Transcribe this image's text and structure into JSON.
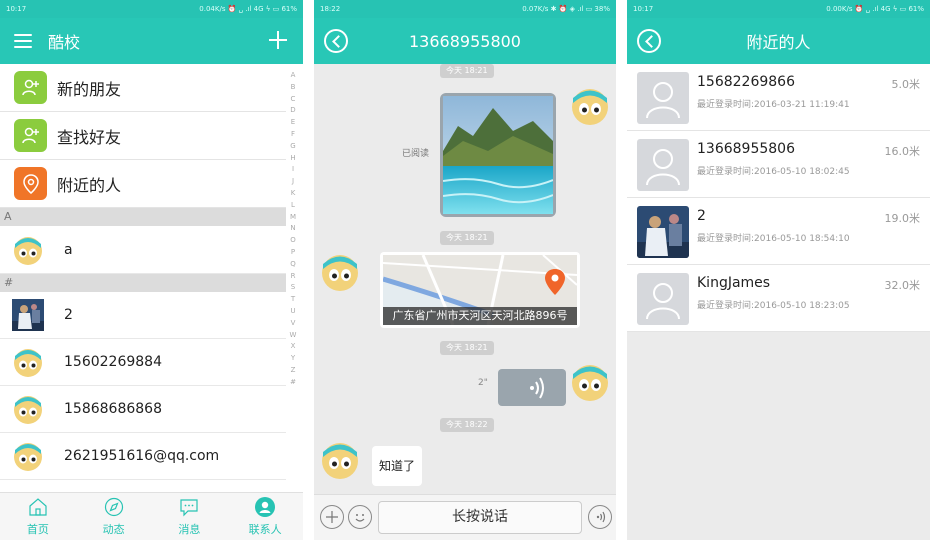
{
  "screen1": {
    "status_time": "10:17",
    "status_right": "0.04K/s ⏰ ␣ .ıl 4G ϟ ▭ 61%",
    "title": "酷校",
    "features": [
      {
        "label": "新的朋友",
        "icon": "person-add-icon",
        "color": "#8bcc3e"
      },
      {
        "label": "查找好友",
        "icon": "person-add-icon",
        "color": "#8bcc3e"
      },
      {
        "label": "附近的人",
        "icon": "location-pin-icon",
        "color": "#f07528"
      }
    ],
    "section_a": "A",
    "section_hash": "#",
    "contacts_a": [
      {
        "name": "a",
        "avatar": "cartoon"
      }
    ],
    "contacts_hash": [
      {
        "name": "2",
        "avatar": "photo"
      },
      {
        "name": "15602269884",
        "avatar": "cartoon"
      },
      {
        "name": "15868686868",
        "avatar": "cartoon"
      },
      {
        "name": "2621951616@qq.com",
        "avatar": "cartoon"
      }
    ],
    "index_letters": [
      "A",
      "B",
      "C",
      "D",
      "E",
      "F",
      "G",
      "H",
      "I",
      "J",
      "K",
      "L",
      "M",
      "N",
      "O",
      "P",
      "Q",
      "R",
      "S",
      "T",
      "U",
      "V",
      "W",
      "X",
      "Y",
      "Z",
      "#"
    ],
    "nav": [
      {
        "label": "首页",
        "icon": "home-icon"
      },
      {
        "label": "动态",
        "icon": "compass-icon"
      },
      {
        "label": "消息",
        "icon": "message-icon"
      },
      {
        "label": "联系人",
        "icon": "contacts-icon"
      }
    ]
  },
  "screen2": {
    "status_time": "18:22",
    "status_right": "0.07K/s ✱ ⏰ ◈ .ıl ▭ 38%",
    "title": "13668955800",
    "timestamps": [
      "今天 18:21",
      "今天 18:21",
      "今天 18:21",
      "今天 18:22"
    ],
    "read_label": "已阅读",
    "location_text": "广东省广州市天河区天河北路896号",
    "voice_duration": "2\"",
    "text_message": "知道了",
    "hold_to_talk": "长按说话"
  },
  "screen3": {
    "status_time": "10:17",
    "status_right": "0.00K/s ⏰ ␣ .ıl 4G ϟ ▭ 61%",
    "title": "附近的人",
    "people": [
      {
        "name": "15682269866",
        "last_login": "最近登录时间:2016-03-21 11:19:41",
        "distance": "5.0米",
        "avatar": "placeholder"
      },
      {
        "name": "13668955806",
        "last_login": "最近登录时间:2016-05-10 18:02:45",
        "distance": "16.0米",
        "avatar": "placeholder"
      },
      {
        "name": "2",
        "last_login": "最近登录时间:2016-05-10 18:54:10",
        "distance": "19.0米",
        "avatar": "photo"
      },
      {
        "name": "KingJames",
        "last_login": "最近登录时间:2016-05-10 18:23:05",
        "distance": "32.0米",
        "avatar": "placeholder"
      }
    ]
  },
  "colors": {
    "accent": "#28c7b6",
    "green": "#8bcc3e",
    "orange": "#f07528",
    "bubble_gray": "#9aa5ad"
  }
}
